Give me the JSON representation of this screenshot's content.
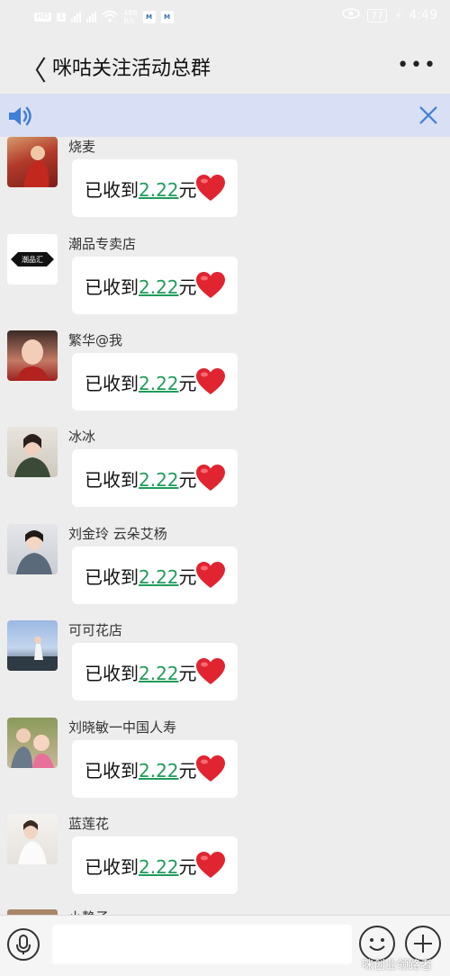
{
  "status_bar": {
    "network": "HD",
    "sim": "1",
    "net_speed": "488\nB/s",
    "battery": "77",
    "time": "4:49"
  },
  "header": {
    "back_label": "〈",
    "title": "咪咕关注活动总群",
    "more_label": "•••"
  },
  "messages": [
    {
      "name": "烧麦",
      "prefix": "已收到",
      "amount": "2.22",
      "suffix": "元"
    },
    {
      "name": "潮品专卖店",
      "prefix": "已收到",
      "amount": "2.22",
      "suffix": "元"
    },
    {
      "name": "繁华@我",
      "prefix": "已收到",
      "amount": "2.22",
      "suffix": "元"
    },
    {
      "name": "冰冰",
      "prefix": "已收到",
      "amount": "2.22",
      "suffix": "元"
    },
    {
      "name": "刘金玲 云朵艾杨",
      "prefix": "已收到",
      "amount": "2.22",
      "suffix": "元"
    },
    {
      "name": "可可花店",
      "prefix": "已收到",
      "amount": "2.22",
      "suffix": "元"
    },
    {
      "name": "刘晓敏一中国人寿",
      "prefix": "已收到",
      "amount": "2.22",
      "suffix": "元"
    },
    {
      "name": "蓝莲花",
      "prefix": "已收到",
      "amount": "2.22",
      "suffix": "元"
    }
  ],
  "partial_next_name": "小静子",
  "avatar_logo_text": "潮品汇",
  "colors": {
    "amount": "#1f9c5a",
    "notice_bg": "#d9dff4",
    "accent_icon": "#3f7fd9"
  },
  "watermark": "咪创业领路者",
  "icons": [
    "back-icon",
    "more-icon",
    "speaker-icon",
    "close-icon",
    "heart-icon",
    "voice-icon",
    "emoji-icon",
    "plus-icon"
  ]
}
